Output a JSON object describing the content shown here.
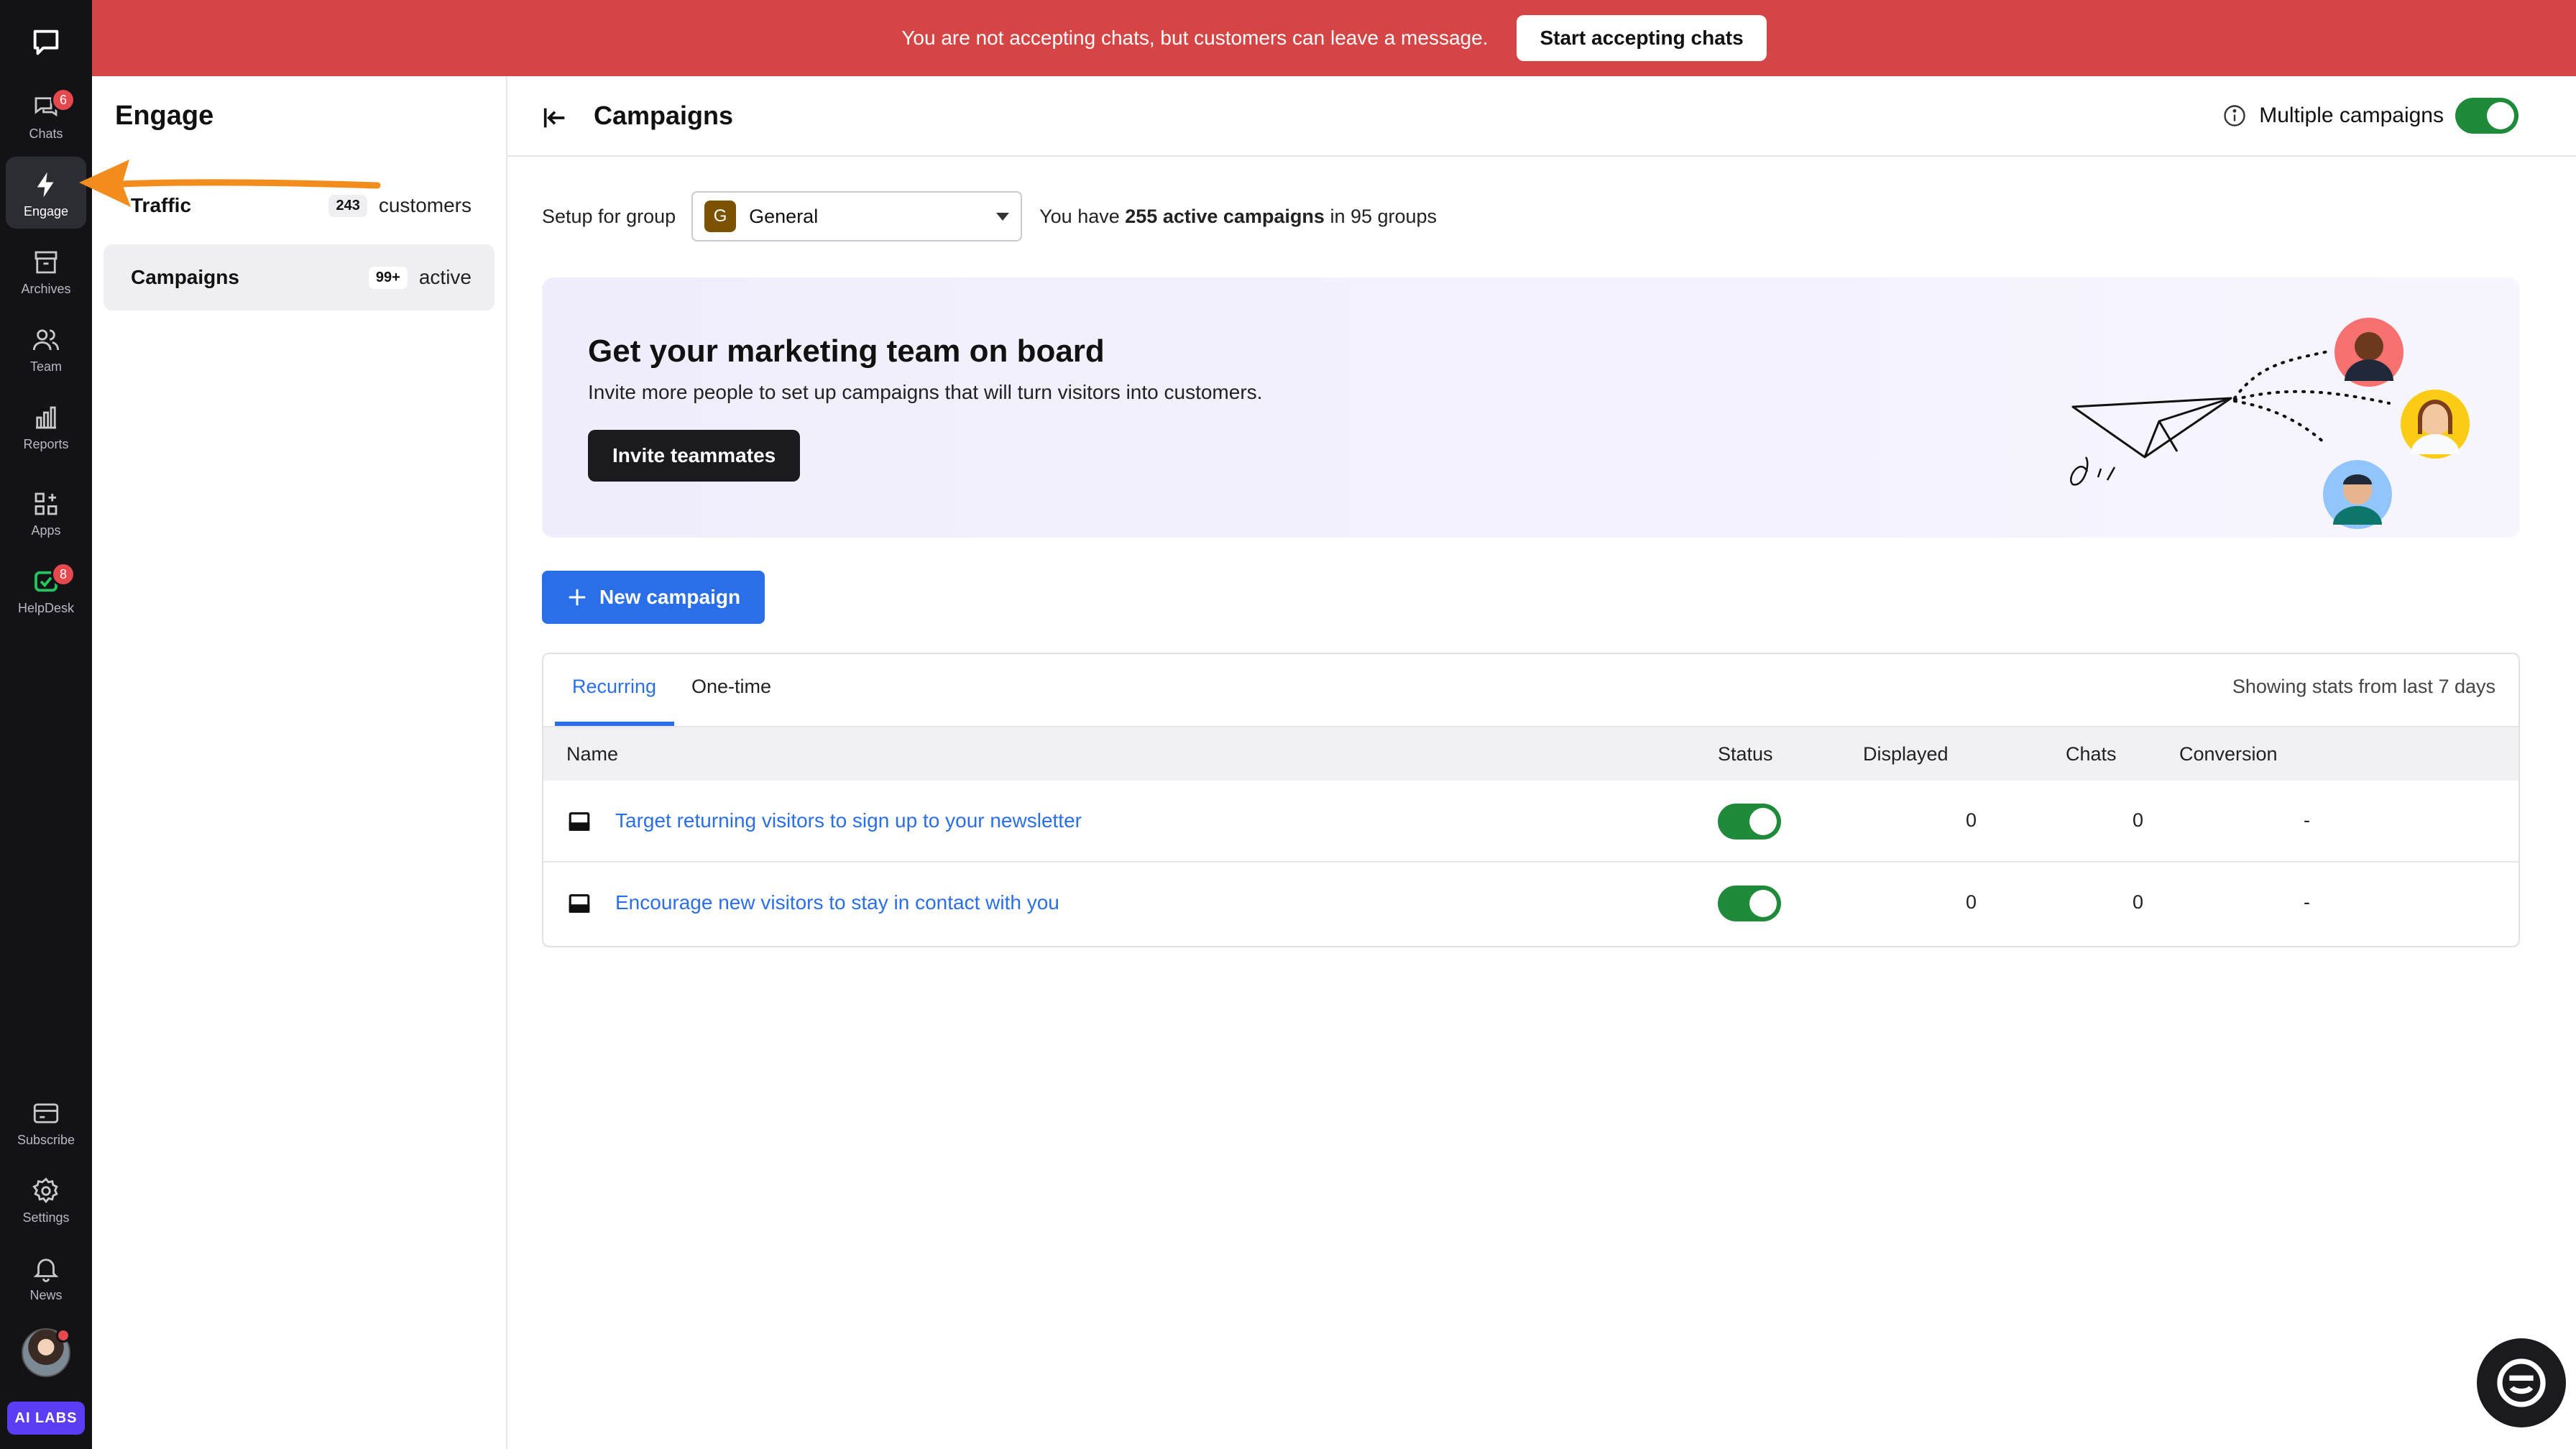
{
  "banner": {
    "message": "You are not accepting chats, but customers can leave a message.",
    "button": "Start accepting chats"
  },
  "rail": {
    "items": [
      {
        "label": "Chats",
        "icon": "chats-icon",
        "badge": "6"
      },
      {
        "label": "Engage",
        "icon": "engage-icon"
      },
      {
        "label": "Archives",
        "icon": "archives-icon"
      },
      {
        "label": "Team",
        "icon": "team-icon"
      },
      {
        "label": "Reports",
        "icon": "reports-icon"
      },
      {
        "label": "Apps",
        "icon": "apps-icon"
      },
      {
        "label": "HelpDesk",
        "icon": "helpdesk-icon",
        "badge": "8"
      }
    ],
    "bottom": [
      {
        "label": "Subscribe",
        "icon": "subscribe-icon"
      },
      {
        "label": "Settings",
        "icon": "settings-icon"
      },
      {
        "label": "News",
        "icon": "news-icon"
      }
    ],
    "ai_labs": "AI LABS"
  },
  "sidebar": {
    "title": "Engage",
    "items": [
      {
        "name": "Traffic",
        "count": "243",
        "unit": "customers"
      },
      {
        "name": "Campaigns",
        "count": "99+",
        "unit": "active"
      }
    ]
  },
  "header": {
    "title": "Campaigns",
    "multi_label": "Multiple campaigns"
  },
  "setup": {
    "label": "Setup for group",
    "group_initial": "G",
    "group_name": "General",
    "info_prefix": "You have ",
    "info_bold": "255 active campaigns",
    "info_suffix": " in 95 groups"
  },
  "promo": {
    "title": "Get your marketing team on board",
    "subtitle": "Invite more people to set up campaigns that will turn visitors into customers.",
    "button": "Invite teammates"
  },
  "new_campaign": "New campaign",
  "table": {
    "tabs": [
      "Recurring",
      "One-time"
    ],
    "stats_note": "Showing stats from last 7 days",
    "columns": [
      "Name",
      "Status",
      "Displayed",
      "Chats",
      "Conversion"
    ],
    "rows": [
      {
        "name": "Target returning visitors to sign up to your newsletter",
        "displayed": "0",
        "chats": "0",
        "conversion": "-"
      },
      {
        "name": "Encourage new visitors to stay in contact with you",
        "displayed": "0",
        "chats": "0",
        "conversion": "-"
      }
    ]
  },
  "colors": {
    "banner": "#d64545",
    "accent": "#2b6fe8",
    "toggle_on": "#1f8a3a",
    "rail": "#131317"
  }
}
